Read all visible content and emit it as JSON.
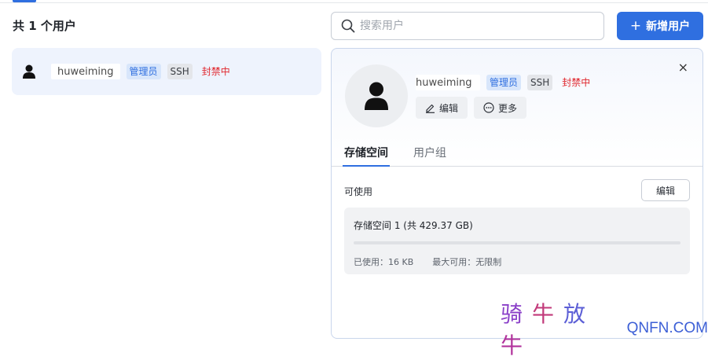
{
  "list": {
    "count_title": "共 1 个用户",
    "users": [
      {
        "name": "huweiming",
        "tags": {
          "admin": "管理员",
          "ssh": "SSH",
          "status": "封禁中"
        }
      }
    ]
  },
  "search": {
    "placeholder": "搜索用户",
    "value": ""
  },
  "toolbar": {
    "add_label": "新增用户",
    "add_plus": "+"
  },
  "detail": {
    "close_label": "×",
    "name": "huweiming",
    "tags": {
      "admin": "管理员",
      "ssh": "SSH",
      "status": "封禁中"
    },
    "actions": {
      "edit_label": "编辑",
      "more_label": "更多"
    },
    "tabs": [
      {
        "label": "存储空间"
      },
      {
        "label": "用户组"
      }
    ],
    "available_label": "可使用",
    "available_edit_label": "编辑",
    "storage": {
      "title": "存储空间 1 (共 429.37 GB)",
      "used_fraction": 0.0,
      "used_text": "已使用：16 KB",
      "max_text": "最大可用：无限制"
    }
  },
  "watermark": {
    "cn_chars": [
      "骑",
      "牛",
      "放",
      "牛"
    ],
    "en": "QNFN.COM"
  },
  "colors": {
    "accent": "#2f6fe0",
    "danger": "#e0262d",
    "selected_row": "#eef3fd"
  },
  "icons": {
    "search": "search-icon",
    "user": "user-icon",
    "edit": "pencil-icon",
    "more": "ellipsis-circle-icon",
    "close": "close-icon"
  }
}
